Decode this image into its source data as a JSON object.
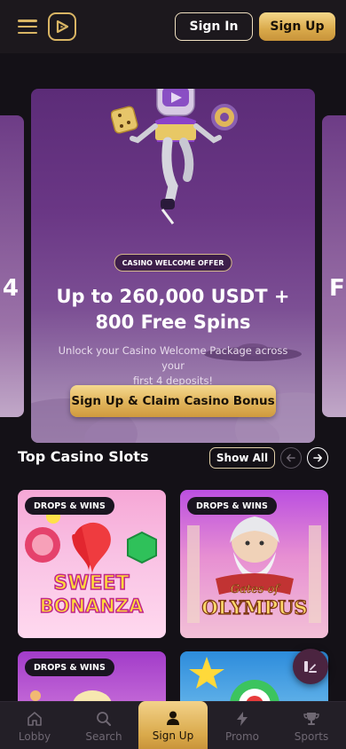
{
  "header": {
    "signin_label": "Sign In",
    "signup_label": "Sign Up",
    "accent_color": "#d9b564"
  },
  "carousel": {
    "left_peek_text": "4",
    "right_peek_text": "F",
    "hero": {
      "badge": "CASINO WELCOME OFFER",
      "title_line1": "Up to 260,000 USDT +",
      "title_line2": "800 Free Spins",
      "subtitle_line1": "Unlock your Casino Welcome Package across your",
      "subtitle_line2": "first 4 deposits!",
      "cta_label": "Sign Up & Claim Casino Bonus"
    }
  },
  "section": {
    "title": "Top Casino Slots",
    "show_all_label": "Show All",
    "prev_icon": "arrow-left-icon",
    "next_icon": "arrow-right-icon"
  },
  "games": [
    {
      "tag": "DROPS & WINS",
      "logo_line1": "SWEET",
      "logo_line2": "BONANZA"
    },
    {
      "tag": "DROPS & WINS",
      "logo_line1": "Gates of",
      "logo_line2": "OLYMPUS"
    },
    {
      "tag": "DROPS & WINS"
    },
    {
      "tag": ""
    }
  ],
  "bottom_nav": [
    {
      "label": "Lobby",
      "icon": "home-icon"
    },
    {
      "label": "Search",
      "icon": "search-icon"
    },
    {
      "label": "Sign Up",
      "icon": "user-icon",
      "active": true
    },
    {
      "label": "Promo",
      "icon": "bolt-icon"
    },
    {
      "label": "Sports",
      "icon": "trophy-icon"
    }
  ],
  "colors": {
    "background": "#141117",
    "gold": "#d9a94a",
    "nav_inactive": "#6f6873"
  }
}
